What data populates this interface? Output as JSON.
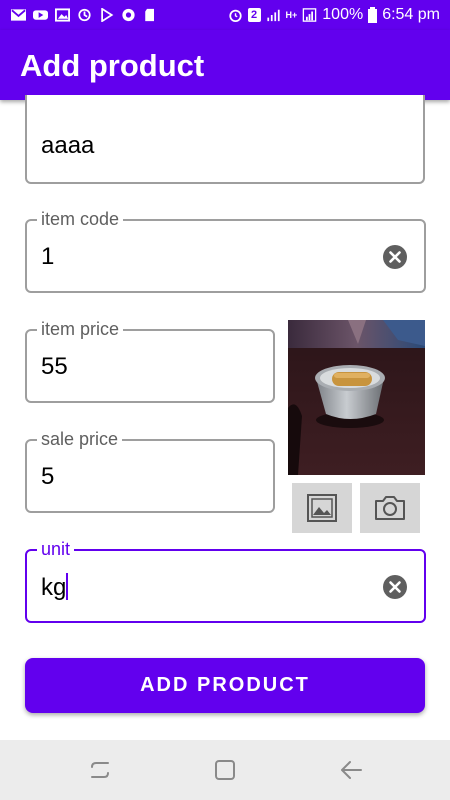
{
  "status_bar": {
    "notification_count": "2",
    "network_type": "H+",
    "battery": "100%",
    "time": "6:54 pm"
  },
  "app_bar": {
    "title": "Add product"
  },
  "form": {
    "name": {
      "value": "aaaa"
    },
    "item_code": {
      "label": "item code",
      "value": "1"
    },
    "item_price": {
      "label": "item price",
      "value": "55"
    },
    "sale_price": {
      "label": "sale price",
      "value": "5"
    },
    "unit": {
      "label": "unit",
      "value": "kg"
    }
  },
  "image_picker": {
    "gallery_icon": "image-icon",
    "camera_icon": "camera-icon"
  },
  "add_button": {
    "label": "ADD PRODUCT"
  },
  "colors": {
    "primary": "#6200ee",
    "outline": "#9e9e9e",
    "nav_bg": "#ececec"
  }
}
